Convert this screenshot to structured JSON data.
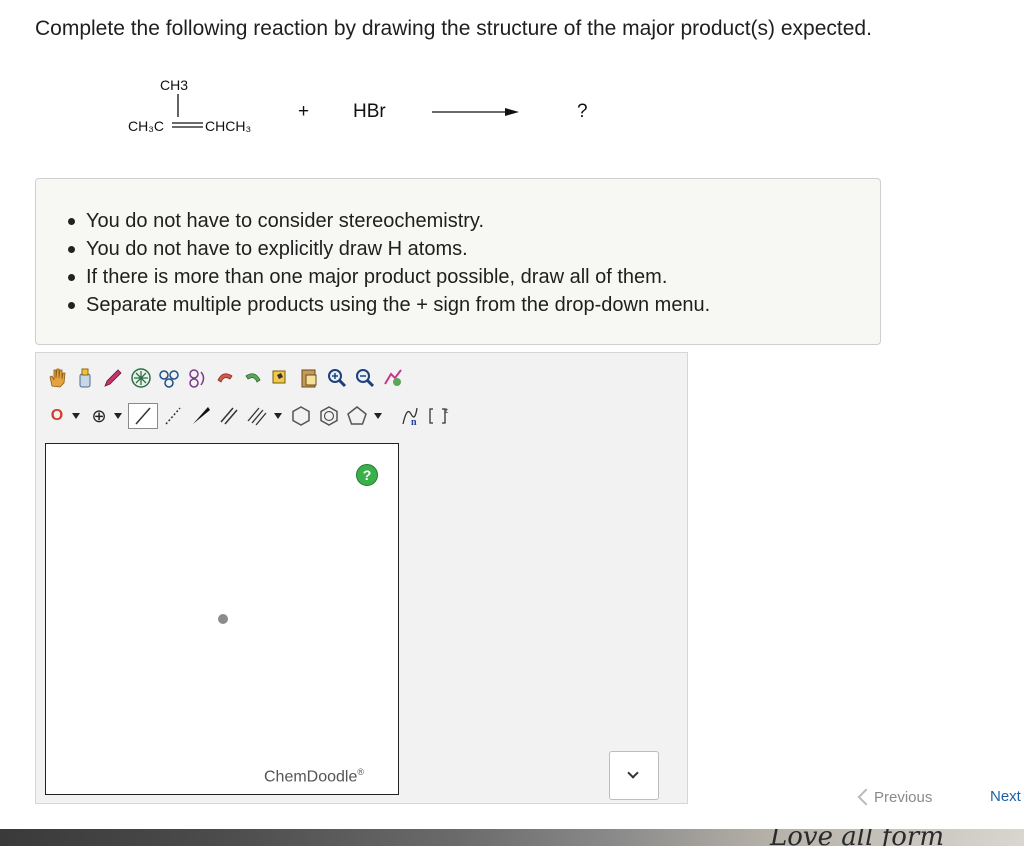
{
  "question": "Complete the following reaction by drawing the structure of the major product(s) expected.",
  "reaction": {
    "reactant_top": "CH3",
    "reactant_main": "CH3C=CHCH3",
    "plus": "+",
    "reagent": "HBr",
    "product": "?"
  },
  "hints": [
    "You do not have to consider stereochemistry.",
    "You do not have to explicitly draw H atoms.",
    "If there is more than one major product possible, draw all of them.",
    "Separate multiple products using the + sign from the drop-down menu."
  ],
  "editor": {
    "toolbar_row1": [
      "hand-tool-icon",
      "eraser-icon",
      "lasso-icon",
      "ring-template-icon",
      "orbital-icon",
      "chain-icon",
      "undo-icon",
      "redo-icon",
      "copy-icon",
      "paste-icon",
      "zoom-in-icon",
      "zoom-out-icon",
      "clean-icon"
    ],
    "element_label": "O",
    "charge_label": "⊕",
    "help_label": "?",
    "brand": "ChemDoodle",
    "brand_mark": "®"
  },
  "navigation": {
    "previous": "Previous",
    "next": "Next"
  },
  "colors": {
    "element_o": "#d43c2a",
    "help_green": "#3bb04a",
    "link_blue": "#1f5fa6"
  }
}
